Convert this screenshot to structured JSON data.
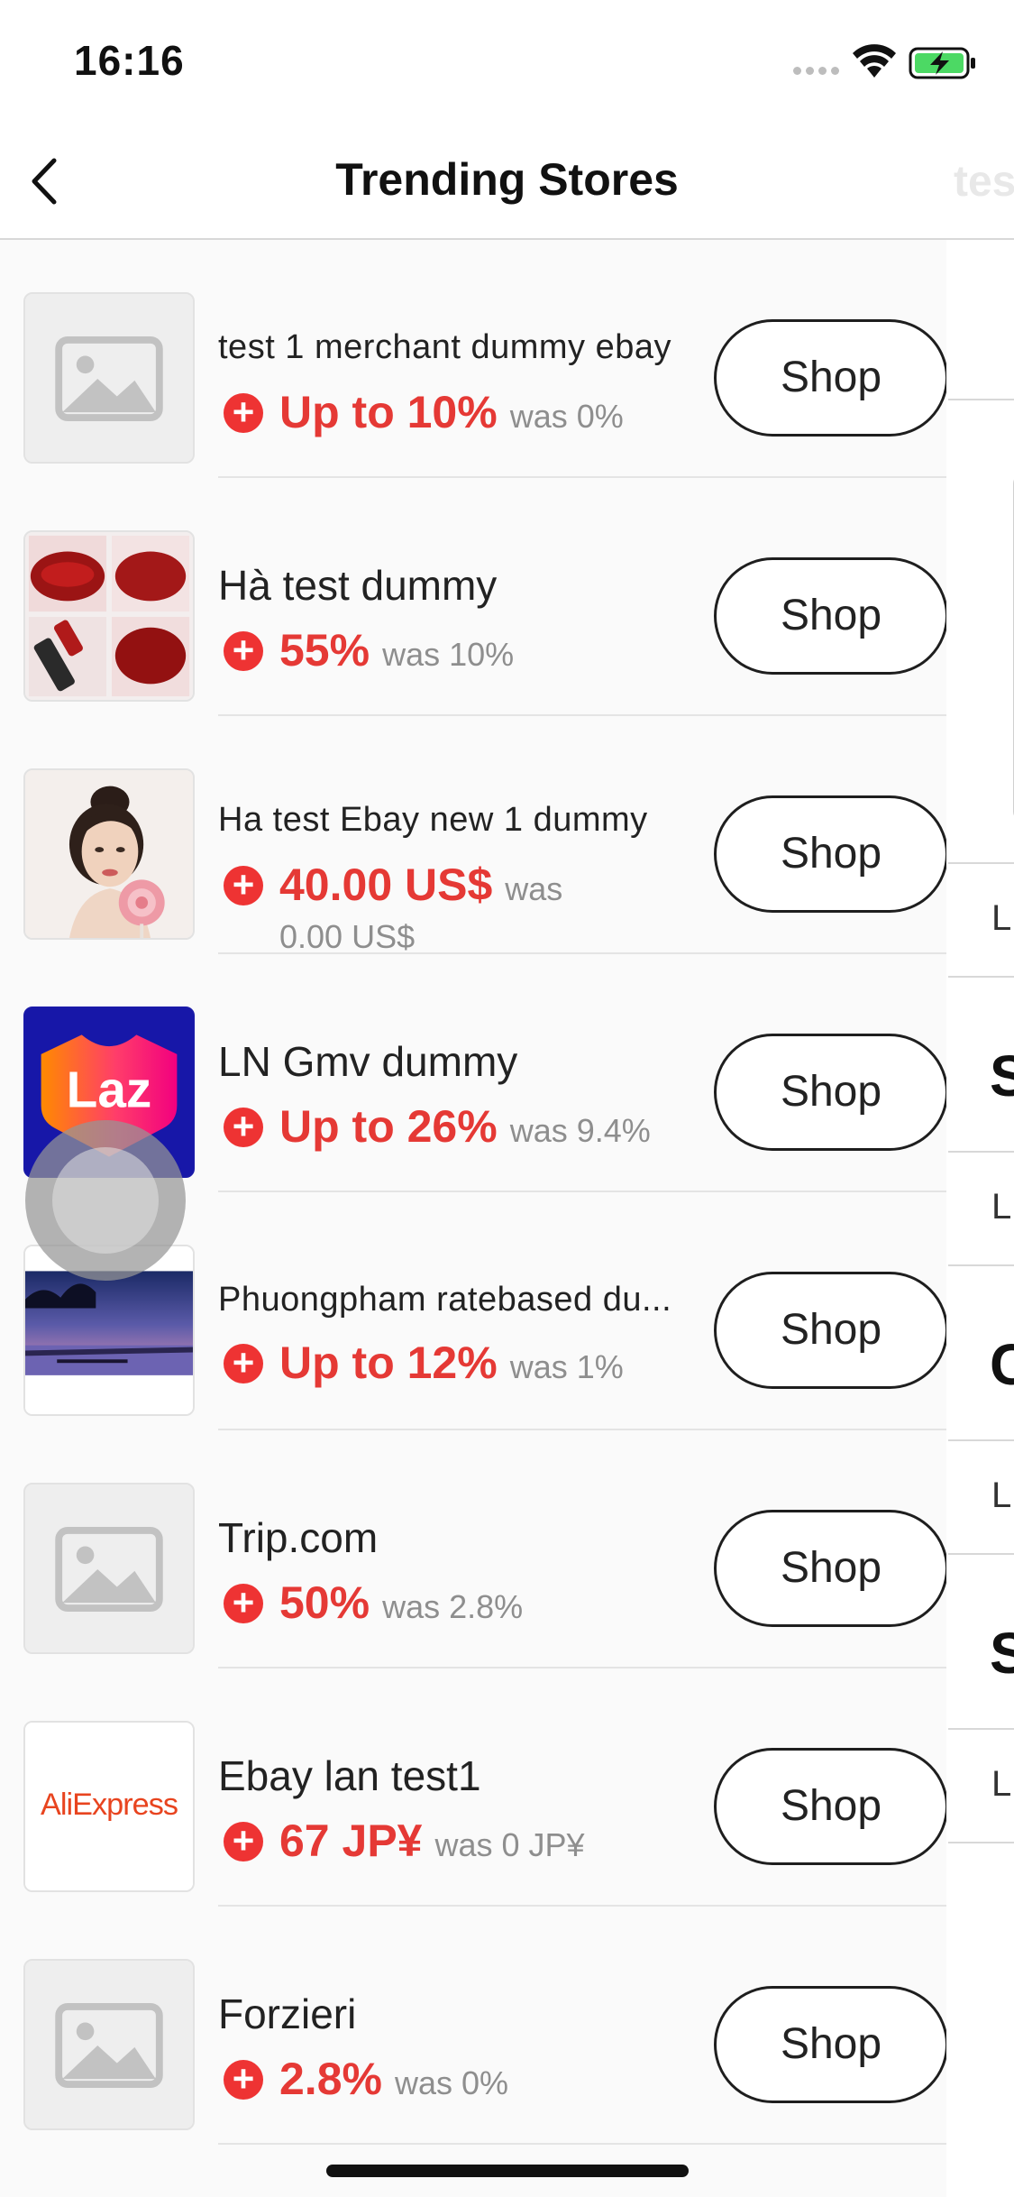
{
  "status": {
    "time": "16:16"
  },
  "nav": {
    "title": "Trending Stores",
    "ghost_tab": "tes",
    "back_icon": "chevron-left-icon"
  },
  "theme": {
    "accent": "#e53935",
    "plus_badge": "#ee3333",
    "muted": "#8e8e8e",
    "battery_green": "#4cd964"
  },
  "stores": [
    {
      "name": "test 1 merchant dummy ebay",
      "rate": "Up to 10%",
      "was": "was 0%",
      "thumb": "placeholder-image-icon"
    },
    {
      "name": "Hà test dummy",
      "rate": "55%",
      "was": "was 10%",
      "thumb": "lipstick-photo"
    },
    {
      "name": "Ha test Ebay new 1 dummy",
      "rate": "40.00 US$",
      "was": "was",
      "was_line2": "0.00 US$",
      "thumb": "portrait-photo"
    },
    {
      "name": "LN Gmv dummy",
      "rate": "Up to 26%",
      "was": "was 9.4%",
      "thumb": "lazada-logo",
      "logo_text": "Laz"
    },
    {
      "name": "Phuongpham ratebased du...",
      "rate": "Up to 12%",
      "was": "was 1%",
      "thumb": "lake-sunset-photo"
    },
    {
      "name": "Trip.com",
      "rate": "50%",
      "was": "was 2.8%",
      "thumb": "placeholder-image-icon"
    },
    {
      "name": "Ebay lan test1",
      "rate": "67 JP¥",
      "was": "was 0 JP¥",
      "thumb": "aliexpress-logo",
      "logo_text": "AliExpress"
    },
    {
      "name": "Forzieri",
      "rate": "2.8%",
      "was": "was 0%",
      "thumb": "placeholder-image-icon"
    }
  ],
  "shop_label": "Shop",
  "plus_symbol": "+",
  "side_panel": {
    "letters": [
      "L",
      "S",
      "L",
      "C",
      "L",
      "S",
      "L"
    ]
  }
}
